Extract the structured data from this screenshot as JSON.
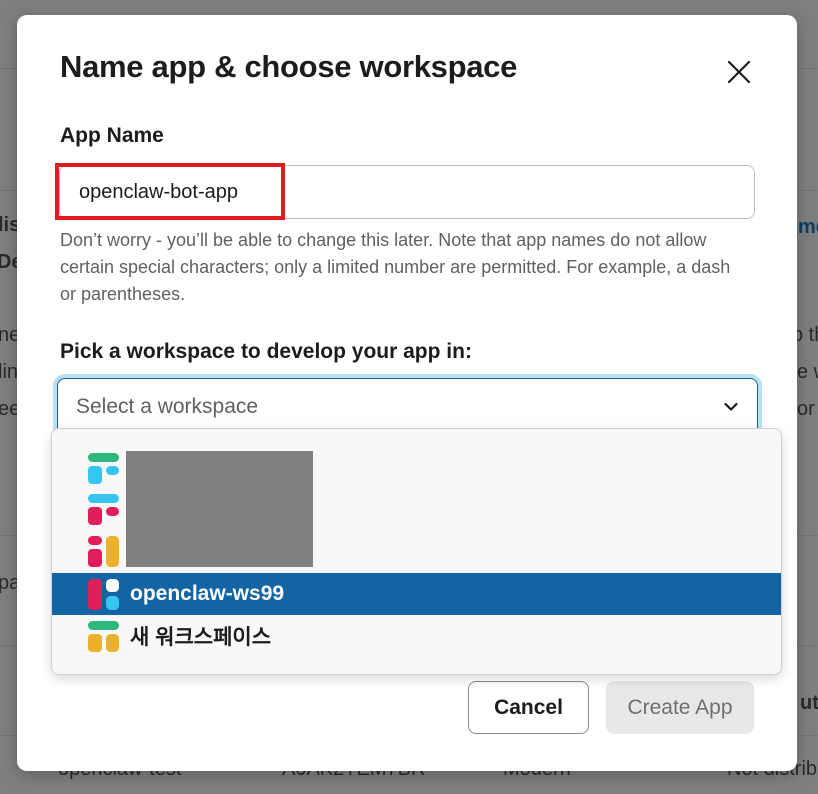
{
  "background": {
    "left_fragments": [
      "lis",
      "De",
      "ne",
      "lin",
      "ee",
      "pa"
    ],
    "right_fragments": [
      "me",
      "o th",
      "e w",
      "or"
    ],
    "bottom_row": [
      "openclaw-test",
      "A0AK2TEM7BR",
      "Modern",
      "Not distrib"
    ],
    "right_bottom_fragment": "ut"
  },
  "modal": {
    "title": "Name app & choose workspace",
    "app_name_label": "App Name",
    "app_name_value": "openclaw-bot-app",
    "help_text": "Don’t worry - you’ll be able to change this later. Note that app names do not allow certain special characters; only a limited number are permitted. For example, a dash or parentheses.",
    "workspace_label": "Pick a workspace to develop your app in:",
    "workspace_placeholder": "Select a workspace",
    "cancel_label": "Cancel",
    "create_label": "Create App"
  },
  "dropdown": {
    "items": [
      {
        "name": "openclaw-ws99",
        "icon": "slack-workspace-icon",
        "selected": true
      },
      {
        "name": "새 워크스페이스",
        "icon": "slack-workspace-icon",
        "selected": false
      }
    ]
  },
  "colors": {
    "accent": "#1264a3",
    "highlight": "#e11b22",
    "green": "#2eb67d",
    "blue": "#36c5f0",
    "red": "#e01e5a",
    "yellow": "#ecb22e"
  }
}
